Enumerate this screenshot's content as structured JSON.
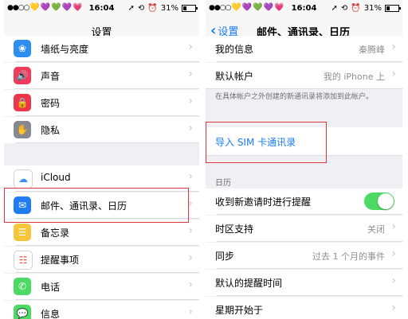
{
  "status_left": {
    "carrier_dots": "●●○○",
    "hearts": [
      "💛",
      "💜",
      "💚",
      "💜",
      "💗"
    ],
    "time": "16:04",
    "battery": "31%",
    "battery_fraction": 0.31
  },
  "status_right": {
    "carrier_dots": "●●○○",
    "hearts": [
      "💛",
      "💜",
      "💚",
      "💜",
      "💗"
    ],
    "time": "16:04",
    "battery": "31%",
    "battery_fraction": 0.31
  },
  "left": {
    "title": "设置",
    "items": [
      {
        "label": "墙纸与亮度",
        "icon": "flower-icon",
        "color": "#2d8ef0"
      },
      {
        "label": "声音",
        "icon": "speaker-icon",
        "color": "#ef3b59"
      },
      {
        "label": "密码",
        "icon": "lock-icon",
        "color": "#ee3549"
      },
      {
        "label": "隐私",
        "icon": "hand-icon",
        "color": "#888890"
      },
      {
        "label": "iCloud",
        "icon": "cloud-icon",
        "color": "#ffffff"
      },
      {
        "label": "邮件、通讯录、日历",
        "icon": "mail-icon",
        "color": "#1f7cf1"
      },
      {
        "label": "备忘录",
        "icon": "notes-icon",
        "color": "#f5c53a"
      },
      {
        "label": "提醒事项",
        "icon": "reminders-icon",
        "color": "#ffffff"
      },
      {
        "label": "电话",
        "icon": "phone-icon",
        "color": "#4cd964"
      },
      {
        "label": "信息",
        "icon": "message-icon",
        "color": "#4cd964"
      }
    ]
  },
  "right": {
    "back_label": "设置",
    "title": "邮件、通讯录、日历",
    "my_info_label": "我的信息",
    "my_info_value": "秦腾峰",
    "default_account_label": "默认帐户",
    "default_account_value": "我的 iPhone 上",
    "footnote": "在具体帐户之外创建的新通讯录将添加到此帐户。",
    "import_sim_label": "导入 SIM 卡通讯录",
    "calendar_header": "日历",
    "invite_alert_label": "收到新邀请时进行提醒",
    "invite_alert_on": true,
    "timezone_label": "时区支持",
    "timezone_value": "关闭",
    "sync_label": "同步",
    "sync_value": "过去 1 个月的事件",
    "default_alert_label": "默认的提醒时间",
    "week_start_label": "星期开始于"
  }
}
